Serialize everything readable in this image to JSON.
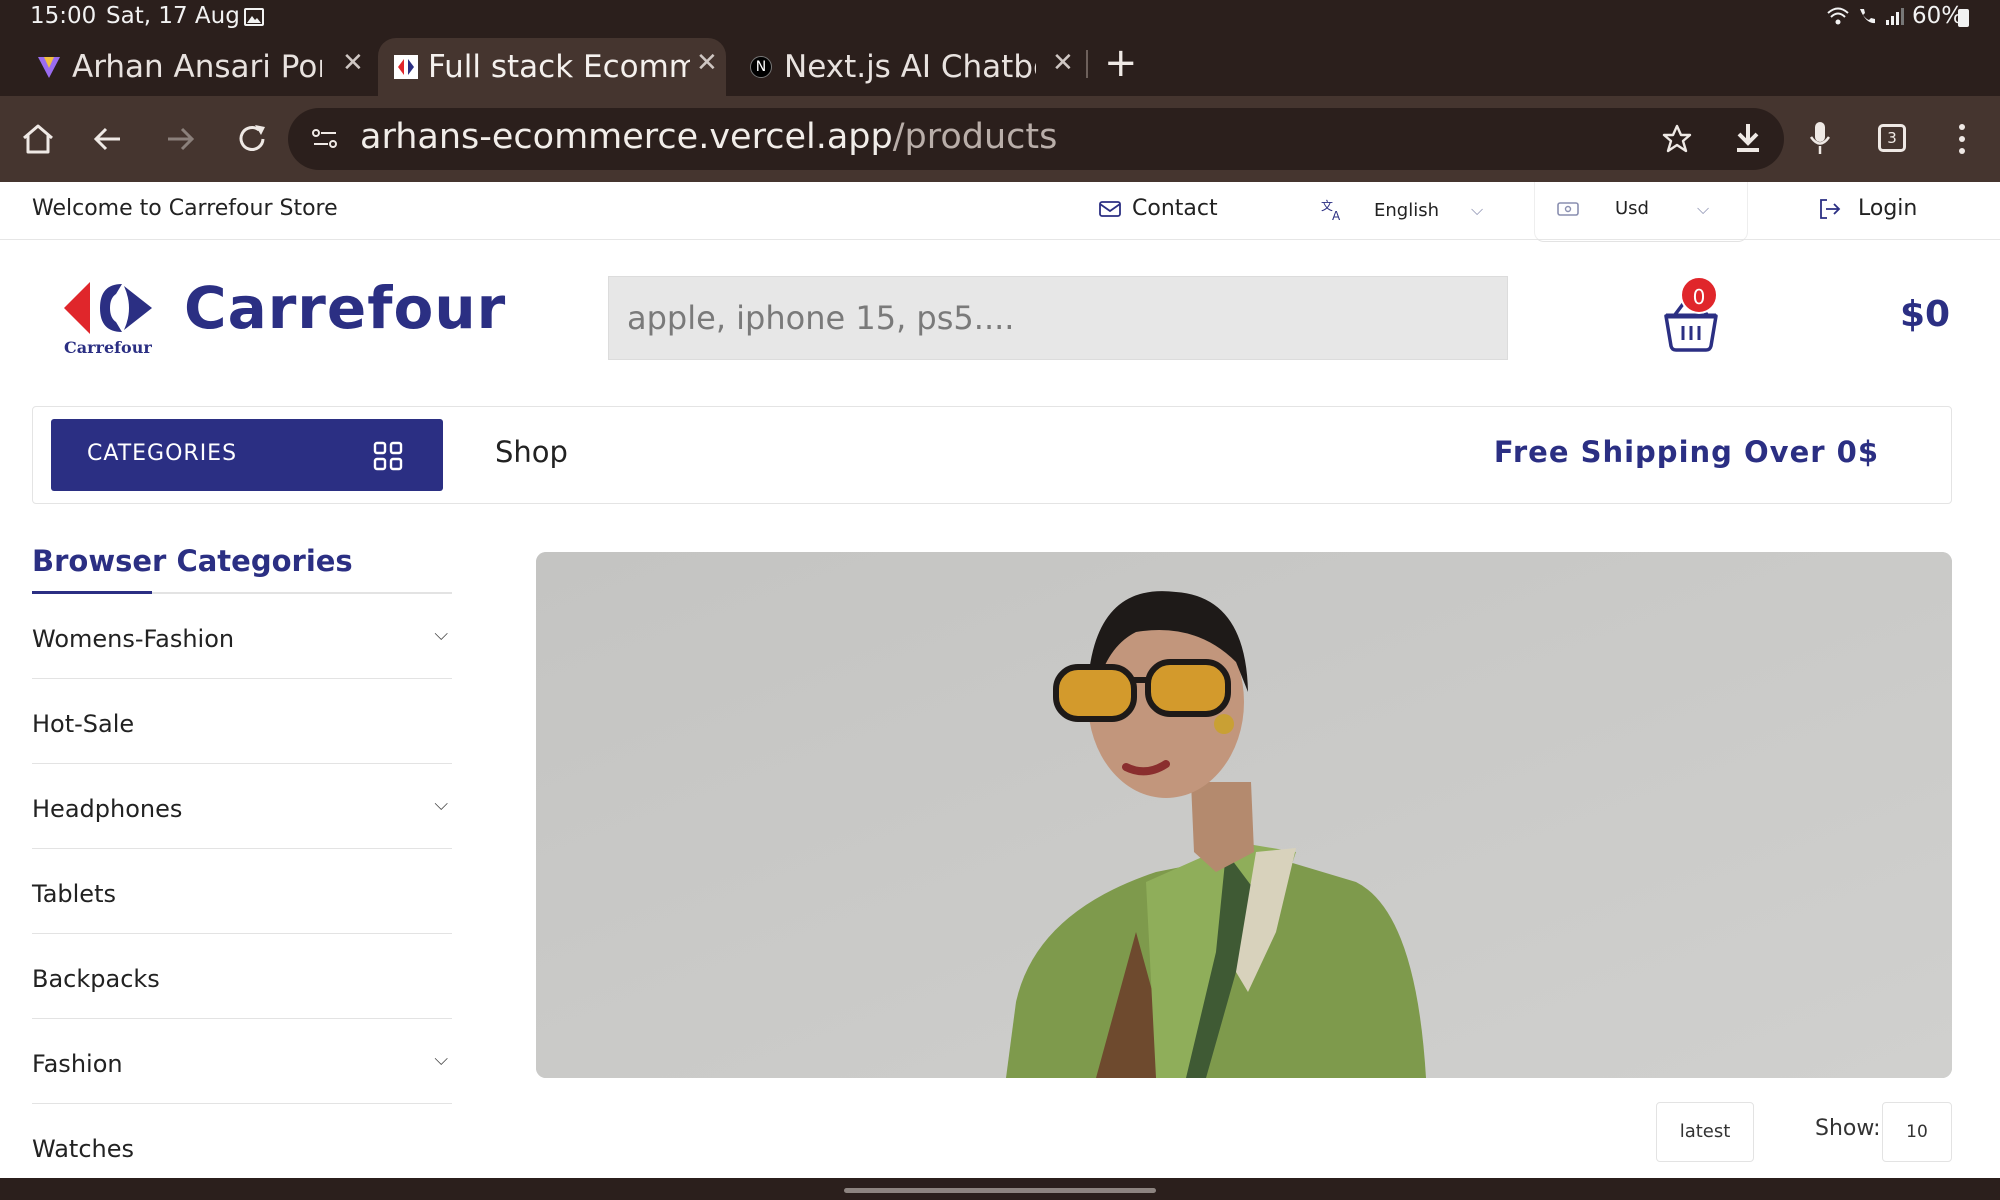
{
  "status": {
    "time": "15:00",
    "date": "Sat, 17 Aug",
    "battery": "60%"
  },
  "tabs": [
    {
      "label": "Arhan Ansari Portf",
      "active": false
    },
    {
      "label": "Full stack Ecomme",
      "active": true
    },
    {
      "label": "Next.js AI Chatbot -",
      "active": false
    }
  ],
  "tab_count": "3",
  "address": {
    "host": "arhans-ecommerce.vercel.app",
    "path": "/products"
  },
  "topbar": {
    "welcome": "Welcome to Carrefour Store",
    "contact": "Contact",
    "language": "English",
    "currency": "Usd",
    "login": "Login"
  },
  "header": {
    "logo_caption": "Carrefour",
    "brand": "Carrefour",
    "search_placeholder": "apple, iphone 15, ps5....",
    "cart_count": "0",
    "cart_total": "$0"
  },
  "nav": {
    "categories_label": "CATEGORIES",
    "shop": "Shop",
    "free_shipping": "Free Shipping Over 0$"
  },
  "sidebar": {
    "title": "Browser Categories",
    "items": [
      {
        "label": "Womens-Fashion",
        "expandable": true
      },
      {
        "label": "Hot-Sale",
        "expandable": false
      },
      {
        "label": "Headphones",
        "expandable": true
      },
      {
        "label": "Tablets",
        "expandable": false
      },
      {
        "label": "Backpacks",
        "expandable": false
      },
      {
        "label": "Fashion",
        "expandable": true
      },
      {
        "label": "Watches",
        "expandable": false
      }
    ]
  },
  "listing": {
    "sort": "latest",
    "show_label": "Show:",
    "show_value": "10"
  },
  "colors": {
    "brand": "#2b2f83",
    "badge": "#e0262b",
    "chrome": "#2b1f1c",
    "chrome_light": "#45352f"
  }
}
